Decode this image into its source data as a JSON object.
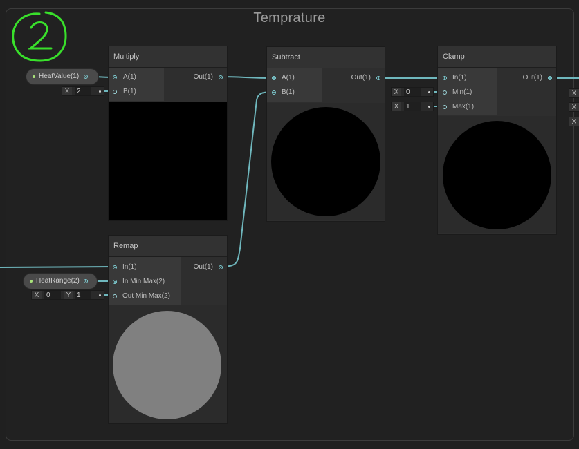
{
  "group": {
    "title": "Temprature"
  },
  "annotation": {
    "text": "2"
  },
  "colors": {
    "wire": "#6fb7bd",
    "port": "#7fd0d6",
    "annotation": "#39e02b",
    "preview_black": "#000000",
    "preview_gray": "#808080"
  },
  "properties": {
    "heat_value": {
      "label": "HeatValue(1)"
    },
    "heat_range": {
      "label": "HeatRange(2)"
    }
  },
  "nodes": {
    "multiply": {
      "title": "Multiply",
      "inputs": [
        "A(1)",
        "B(1)"
      ],
      "output": "Out(1)",
      "b_default": {
        "axis": "X",
        "value": "2"
      }
    },
    "subtract": {
      "title": "Subtract",
      "inputs": [
        "A(1)",
        "B(1)"
      ],
      "output": "Out(1)"
    },
    "clamp": {
      "title": "Clamp",
      "inputs": [
        "In(1)",
        "Min(1)",
        "Max(1)"
      ],
      "output": "Out(1)",
      "min_default": {
        "axis": "X",
        "value": "0"
      },
      "max_default": {
        "axis": "X",
        "value": "1"
      }
    },
    "remap": {
      "title": "Remap",
      "inputs": [
        "In(1)",
        "In Min Max(2)",
        "Out Min Max(2)"
      ],
      "output": "Out(1)",
      "out_min_max_default": {
        "x_axis": "X",
        "x_value": "0",
        "y_axis": "Y",
        "y_value": "1"
      }
    }
  },
  "offscreen_axes": [
    "X",
    "X",
    "X"
  ]
}
